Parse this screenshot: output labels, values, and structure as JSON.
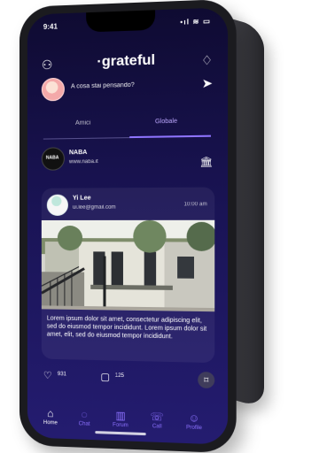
{
  "status": {
    "time": "9:41",
    "icons": "•ıl ≋ ▭"
  },
  "header": {
    "app_name": "·grateful",
    "left_icon": "users-icon",
    "right_icon": "bell-icon"
  },
  "composer": {
    "prompt": "A cosa stai pensando?",
    "send_icon": "send-icon"
  },
  "tabs": [
    {
      "label": "Amici"
    },
    {
      "label": "Globale"
    }
  ],
  "featured": {
    "name": "NABA",
    "url": "www.naba.it",
    "action_icon": "bank-icon"
  },
  "post": {
    "author": "Yi Lee",
    "email": "ui.lee@gmail.com",
    "time": "10:00 am",
    "text": "Lorem ipsum dolor sit amet, consectetur adipiscing elit, sed do eiusmod tempor incididunt. Lorem ipsum dolor sit amet, elit, sed do eiusmod tempor incididunt.",
    "likes": "931",
    "comments": "125"
  },
  "bottom_nav": [
    {
      "label": "Home"
    },
    {
      "label": "Chat"
    },
    {
      "label": "Forum"
    },
    {
      "label": "Call"
    },
    {
      "label": "Profile"
    }
  ],
  "colors": {
    "screen_top": "#0f0b32",
    "screen_bottom": "#241c70",
    "accent": "#8f74ff",
    "device": "#1b1b1f",
    "background": "#ffffff"
  }
}
